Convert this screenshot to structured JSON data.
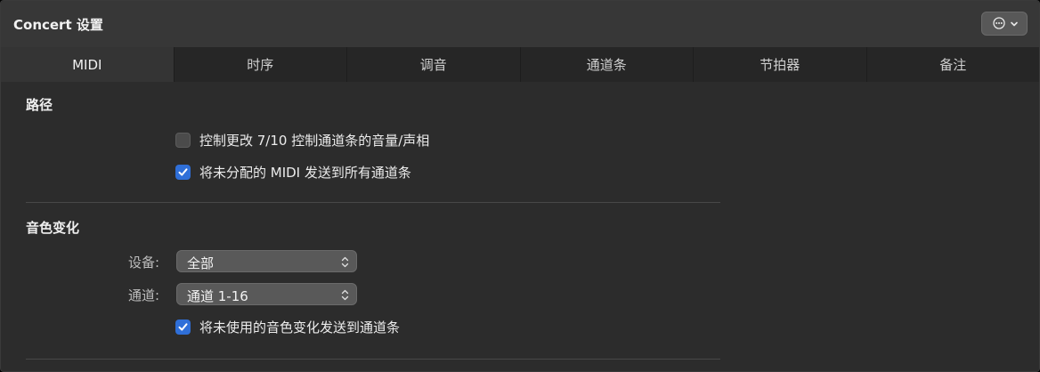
{
  "window": {
    "title": "Concert 设置",
    "menu_icon": "ellipsis-circle-icon",
    "menu_chevron_icon": "chevron-down-icon"
  },
  "tabs": [
    {
      "label": "MIDI",
      "active": true
    },
    {
      "label": "时序",
      "active": false
    },
    {
      "label": "调音",
      "active": false
    },
    {
      "label": "通道条",
      "active": false
    },
    {
      "label": "节拍器",
      "active": false
    },
    {
      "label": "备注",
      "active": false
    }
  ],
  "routing": {
    "title": "路径",
    "options": [
      {
        "label": "控制更改 7/10 控制通道条的音量/声相",
        "checked": false
      },
      {
        "label": "将未分配的 MIDI 发送到所有通道条",
        "checked": true
      }
    ]
  },
  "program_change": {
    "title": "音色变化",
    "device_label": "设备:",
    "device_value": "全部",
    "channel_label": "通道:",
    "channel_value": "通道 1-16",
    "option": {
      "label": "将未使用的音色变化发送到通道条",
      "checked": true
    }
  },
  "colors": {
    "checkbox_accent": "#2f6fd8",
    "background": "#2c2c2c",
    "titlebar": "#373737"
  }
}
